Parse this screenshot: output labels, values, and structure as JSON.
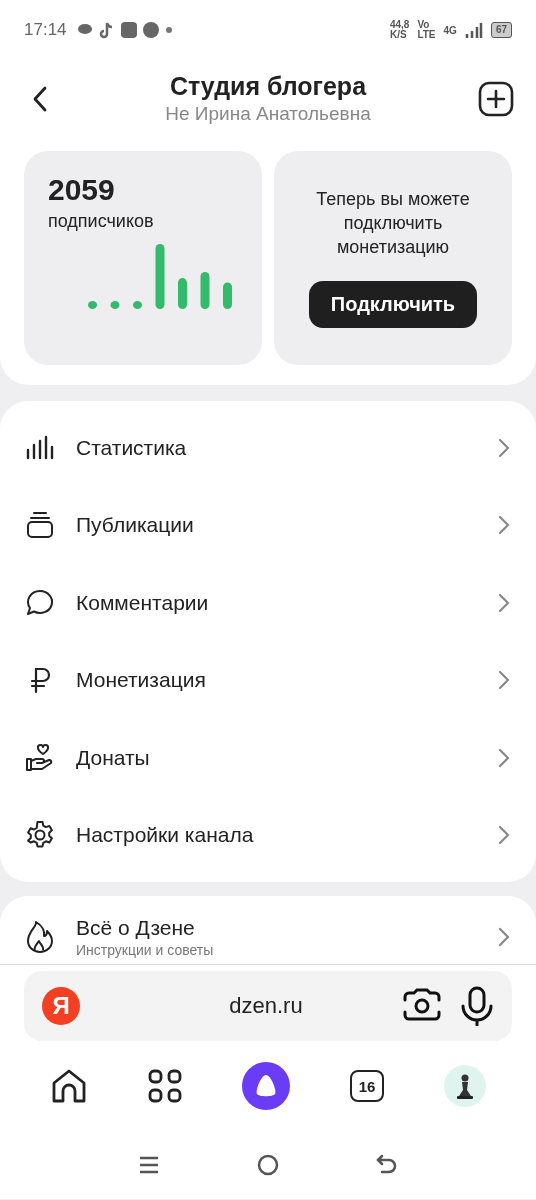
{
  "status_bar": {
    "time": "17:14",
    "speed": "44,8",
    "speed_unit": "K/S",
    "volte": "Vo",
    "lte": "LTE",
    "network": "4G",
    "battery": "67"
  },
  "header": {
    "title": "Студия блогера",
    "subtitle": "Не Ирина Анатольевна"
  },
  "subscribers_card": {
    "count": "2059",
    "label": "подписчиков"
  },
  "monetization_card": {
    "text": "Теперь вы можете подключить монетизацию",
    "button": "Подключить"
  },
  "menu": {
    "items": [
      {
        "kind": "statistics",
        "label": "Статистика"
      },
      {
        "kind": "publications",
        "label": "Публикации"
      },
      {
        "kind": "comments",
        "label": "Комментарии"
      },
      {
        "kind": "monetization",
        "label": "Монетизация"
      },
      {
        "kind": "donations",
        "label": "Донаты"
      },
      {
        "kind": "settings",
        "label": "Настройки канала"
      }
    ]
  },
  "about": {
    "title": "Всё о Дзене",
    "subtitle": "Инструкции и советы"
  },
  "browser_bar": {
    "logo": "Я",
    "url": "dzen.ru"
  },
  "bottom_nav": {
    "tabs_count": "16"
  }
}
